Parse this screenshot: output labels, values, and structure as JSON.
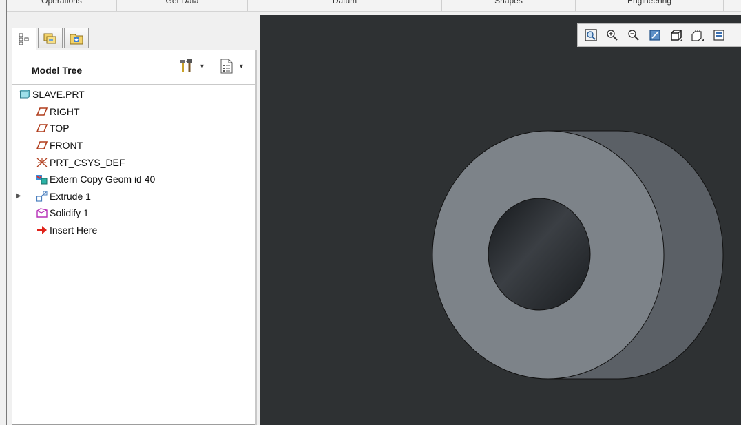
{
  "ribbon": {
    "groups": [
      "Operations",
      "Get Data",
      "Datum",
      "Shapes",
      "Engineering"
    ]
  },
  "navigator": {
    "tabs": [
      {
        "name": "model-tree-tab-icon",
        "active": true
      },
      {
        "name": "folder-browser-tab-icon",
        "active": false
      },
      {
        "name": "favorites-tab-icon",
        "active": false
      }
    ],
    "title": "Model Tree",
    "settings_icon": "tree-settings-icon",
    "show_icon": "tree-show-icon"
  },
  "tree": {
    "items": [
      {
        "label": "SLAVE.PRT",
        "icon": "part-icon",
        "indent": 0,
        "expandable": false
      },
      {
        "label": "RIGHT",
        "icon": "datum-plane-icon",
        "indent": 1,
        "expandable": false
      },
      {
        "label": "TOP",
        "icon": "datum-plane-icon",
        "indent": 1,
        "expandable": false
      },
      {
        "label": "FRONT",
        "icon": "datum-plane-icon",
        "indent": 1,
        "expandable": false
      },
      {
        "label": "PRT_CSYS_DEF",
        "icon": "coordinate-system-icon",
        "indent": 1,
        "expandable": false
      },
      {
        "label": "Extern Copy Geom id 40",
        "icon": "extern-copy-geom-icon",
        "indent": 1,
        "expandable": false
      },
      {
        "label": "Extrude 1",
        "icon": "extrude-icon",
        "indent": 1,
        "expandable": true
      },
      {
        "label": "Solidify 1",
        "icon": "solidify-icon",
        "indent": 1,
        "expandable": false
      },
      {
        "label": "Insert Here",
        "icon": "insert-here-icon",
        "indent": 1,
        "expandable": false
      }
    ]
  },
  "view_toolbar": {
    "buttons": [
      "refit-icon",
      "zoom-in-icon",
      "zoom-out-icon",
      "repaint-icon",
      "display-style-icon",
      "saved-orientations-icon",
      "view-manager-icon"
    ]
  },
  "colors": {
    "graphics_background": "#2e3133",
    "model_face": "#7d8389",
    "model_side": "#5b6066",
    "datum_plane": "#b03d1c",
    "solidify": "#b72fb7",
    "insert_here": "#e0231a"
  }
}
